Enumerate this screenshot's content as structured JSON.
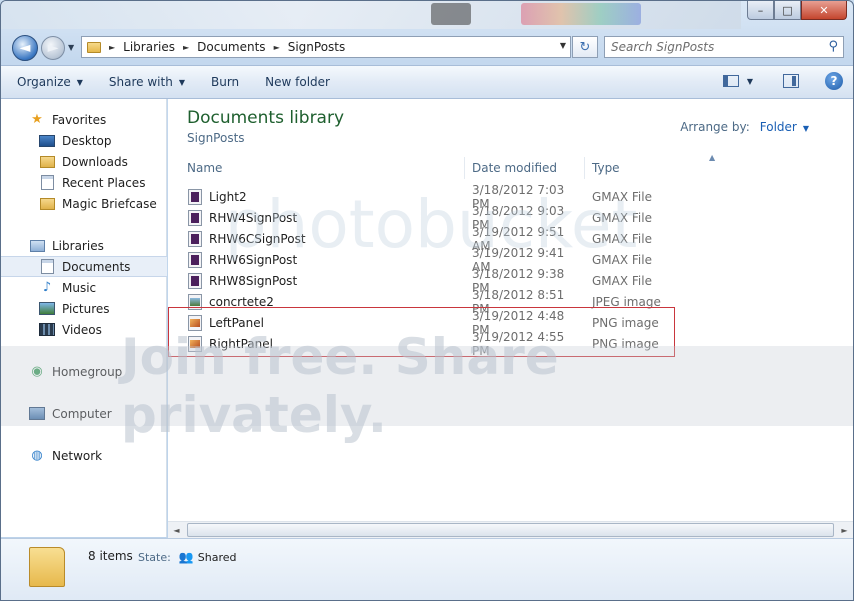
{
  "window": {
    "controls": {
      "minimize": "–",
      "maximize": "□",
      "close": "✕"
    }
  },
  "address": {
    "back_icon": "◄",
    "forward_icon": "►",
    "recent_icon": "▼",
    "crumbs": [
      "Libraries",
      "Documents",
      "SignPosts"
    ],
    "crumb_arrow": "►",
    "dropdown_icon": "▼",
    "refresh_icon": "↻"
  },
  "search": {
    "placeholder": "Search SignPosts",
    "icon": "⚲"
  },
  "toolbar": {
    "organize": "Organize",
    "share_with": "Share with",
    "burn": "Burn",
    "new_folder": "New folder",
    "caret": "▼",
    "help": "?"
  },
  "nav": {
    "favorites_header": "Favorites",
    "favorites": [
      "Desktop",
      "Downloads",
      "Recent Places",
      "Magic Briefcase"
    ],
    "libraries_header": "Libraries",
    "libraries": [
      "Documents",
      "Music",
      "Pictures",
      "Videos"
    ],
    "homegroup": "Homegroup",
    "computer": "Computer",
    "network": "Network",
    "icons": {
      "star": "★",
      "music": "♪",
      "homegroup": "◉",
      "network": "◍"
    }
  },
  "library": {
    "title": "Documents library",
    "subtitle": "SignPosts",
    "arrange_label": "Arrange by:",
    "arrange_value": "Folder",
    "arrange_caret": "▼"
  },
  "columns": {
    "name": "Name",
    "date": "Date modified",
    "type": "Type",
    "sort_icon": "▲"
  },
  "files": [
    {
      "name": "Light2",
      "date": "3/18/2012 7:03 PM",
      "type": "GMAX File",
      "icon": "gmax"
    },
    {
      "name": "RHW4SignPost",
      "date": "3/18/2012 9:03 PM",
      "type": "GMAX File",
      "icon": "gmax"
    },
    {
      "name": "RHW6CSignPost",
      "date": "3/19/2012 9:51 AM",
      "type": "GMAX File",
      "icon": "gmax"
    },
    {
      "name": "RHW6SignPost",
      "date": "3/19/2012 9:41 AM",
      "type": "GMAX File",
      "icon": "gmax"
    },
    {
      "name": "RHW8SignPost",
      "date": "3/18/2012 9:38 PM",
      "type": "GMAX File",
      "icon": "gmax"
    },
    {
      "name": "concrtete2",
      "date": "3/18/2012 8:51 PM",
      "type": "JPEG image",
      "icon": "jpeg"
    },
    {
      "name": "LeftPanel",
      "date": "3/19/2012 4:48 PM",
      "type": "PNG image",
      "icon": "png"
    },
    {
      "name": "RightPanel",
      "date": "3/19/2012 4:55 PM",
      "type": "PNG image",
      "icon": "png"
    }
  ],
  "scroll": {
    "left": "◄",
    "right": "►"
  },
  "watermark": {
    "top": "photobucket",
    "bottom": "Join free. Share privately."
  },
  "details": {
    "count": "8 items",
    "state_label": "State:",
    "state_value": "Shared",
    "shared_icon": "👥"
  }
}
